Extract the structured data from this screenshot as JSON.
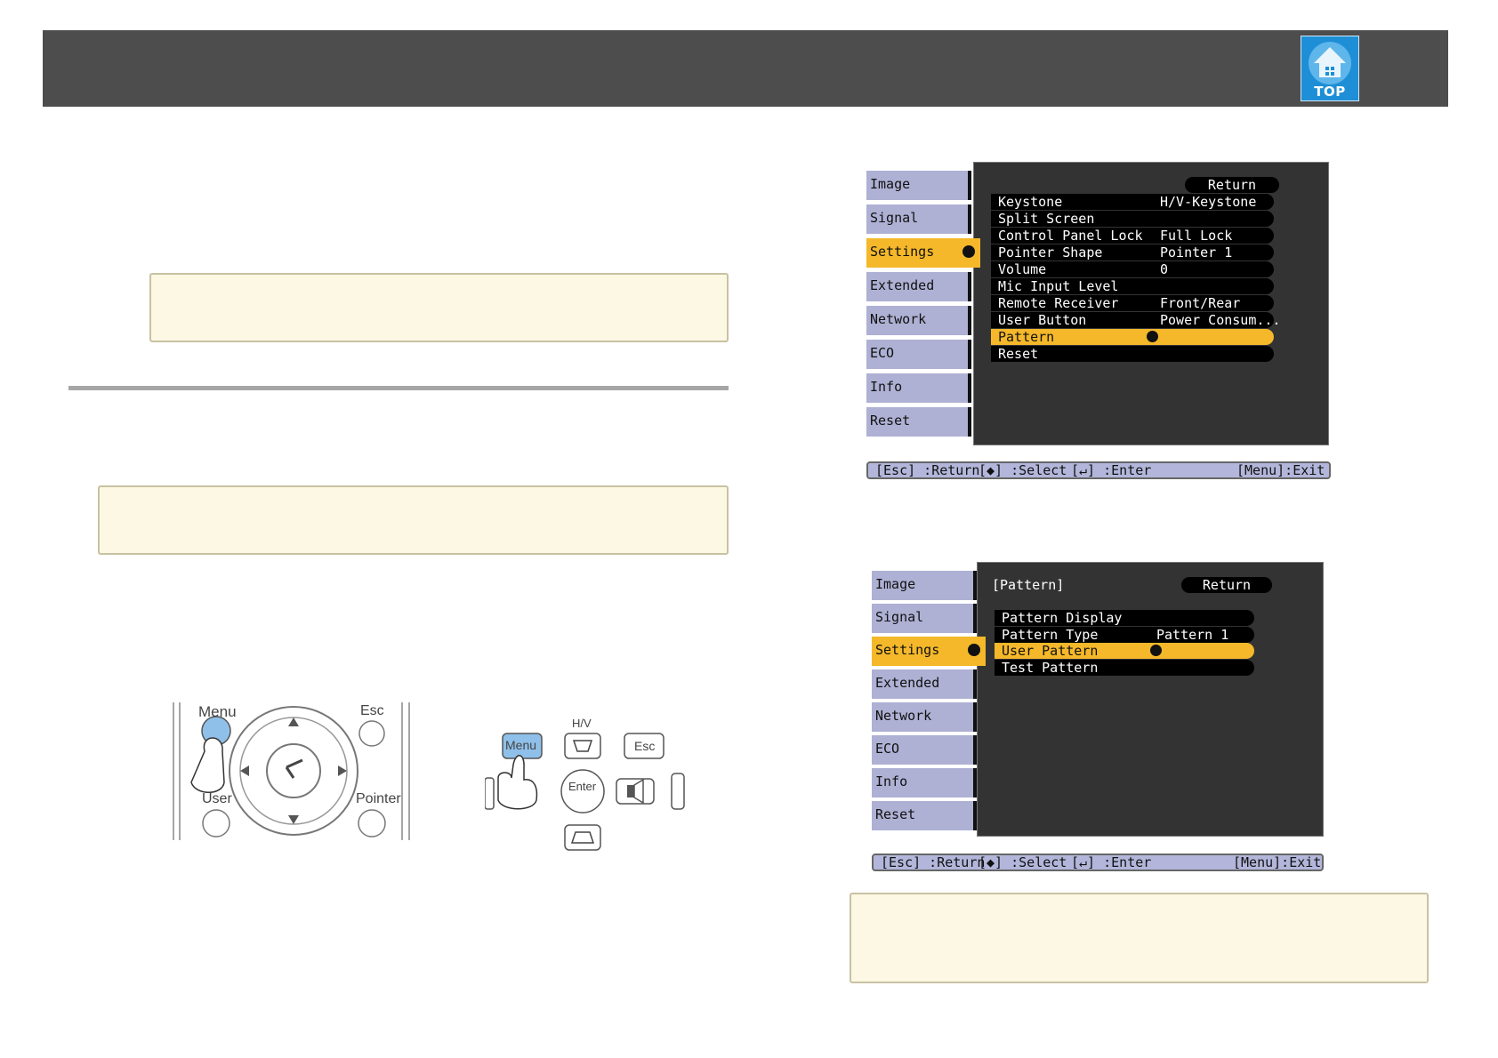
{
  "header": {
    "badge_label": "TOP",
    "badge_icon": "home-icon"
  },
  "menu1": {
    "tabs": [
      "Image",
      "Signal",
      "Settings",
      "Extended",
      "Network",
      "ECO",
      "Info",
      "Reset"
    ],
    "selected_tab": "Settings",
    "return_label": "Return",
    "rows": [
      {
        "label": "Keystone",
        "value": "H/V-Keystone"
      },
      {
        "label": "Split Screen",
        "value": ""
      },
      {
        "label": "Control Panel Lock",
        "value": "Full Lock"
      },
      {
        "label": "Pointer Shape",
        "value": "Pointer 1"
      },
      {
        "label": "Volume",
        "value": "0"
      },
      {
        "label": "Mic Input Level",
        "value": ""
      },
      {
        "label": "Remote Receiver",
        "value": "Front/Rear"
      },
      {
        "label": "User Button",
        "value": "Power Consum..."
      },
      {
        "label": "Pattern",
        "value": ""
      },
      {
        "label": "Reset",
        "value": ""
      }
    ],
    "selected_row": "Pattern",
    "status": {
      "esc": "[Esc] :Return",
      "select": "[◆] :Select",
      "enter": "[↵] :Enter",
      "menu": "[Menu]:Exit"
    }
  },
  "menu2": {
    "tabs": [
      "Image",
      "Signal",
      "Settings",
      "Extended",
      "Network",
      "ECO",
      "Info",
      "Reset"
    ],
    "selected_tab": "Settings",
    "title": "[Pattern]",
    "return_label": "Return",
    "rows": [
      {
        "label": "Pattern Display",
        "value": ""
      },
      {
        "label": "Pattern Type",
        "value": "Pattern 1"
      },
      {
        "label": "User Pattern",
        "value": ""
      },
      {
        "label": "Test Pattern",
        "value": ""
      }
    ],
    "selected_row": "User Pattern",
    "status": {
      "esc": "[Esc] :Return",
      "select": "[◆] :Select",
      "enter": "[↵] :Enter",
      "menu": "[Menu]:Exit"
    }
  },
  "remote": {
    "menu": "Menu",
    "esc": "Esc",
    "user": "User",
    "pointer": "Pointer"
  },
  "panel": {
    "menu": "Menu",
    "hv": "H/V",
    "esc": "Esc",
    "enter": "Enter"
  }
}
